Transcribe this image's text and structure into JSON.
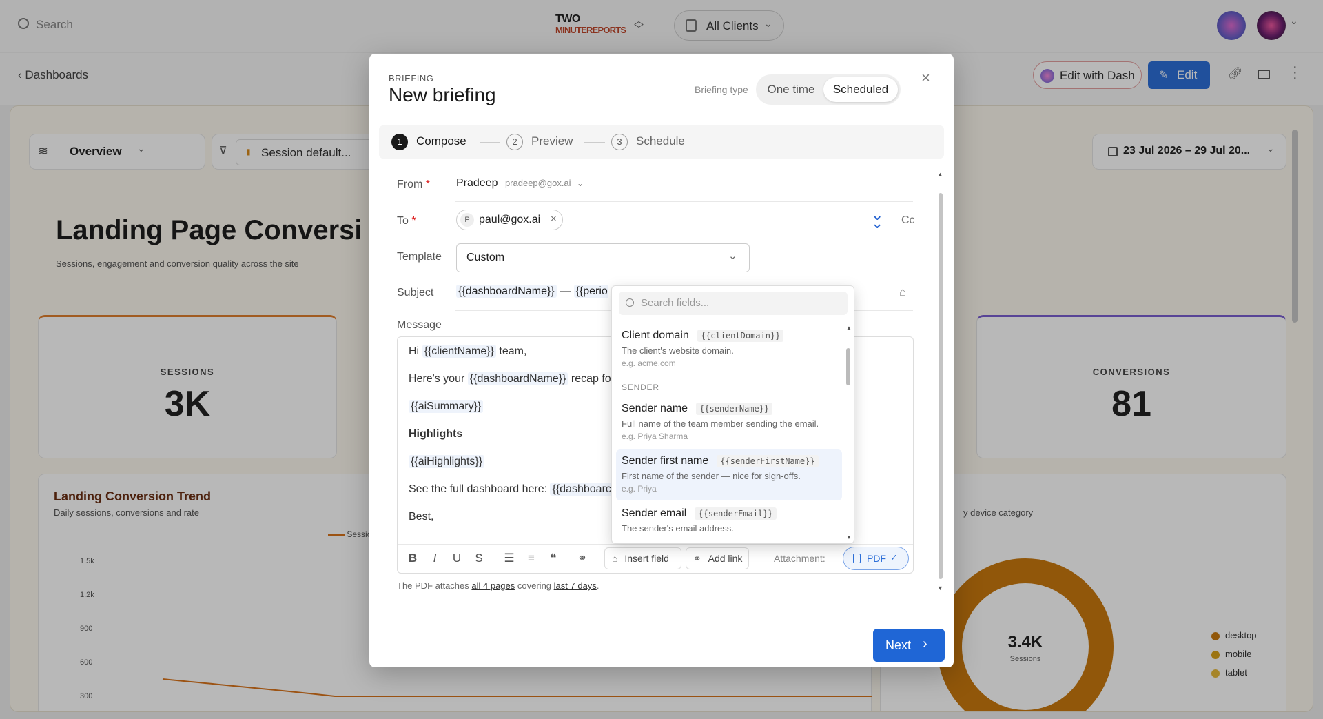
{
  "app": {
    "search_placeholder": "Search",
    "logo_line1": "TWO",
    "logo_line2": "MINUTEREPORTS",
    "client_selector": "All Clients"
  },
  "subbar": {
    "back_label": "Dashboards",
    "edit_with_dash": "Edit with Dash",
    "edit": "Edit"
  },
  "dashboard": {
    "tab": "Overview",
    "filter_chip": "Session default...",
    "date_range": "23 Jul 2026 – 29 Jul 20...",
    "title": "Landing Page Conversi",
    "subtitle": "Sessions, engagement and conversion quality across the site",
    "kpis": [
      {
        "label": "SESSIONS",
        "value": "3K"
      },
      {
        "label": "CONVERSIONS",
        "value": "81"
      }
    ],
    "trend": {
      "title": "Landing Conversion Trend",
      "subtitle": "Daily sessions, conversions and rate",
      "legend": "Sessio",
      "yticks": [
        "1.5k",
        "1.2k",
        "900",
        "600",
        "300"
      ]
    },
    "donut": {
      "subtitle": "y device category",
      "center_value": "3.4K",
      "center_label": "Sessions",
      "legend": [
        {
          "label": "desktop",
          "color": "#c9790f"
        },
        {
          "label": "mobile",
          "color": "#d9a21b"
        },
        {
          "label": "tablet",
          "color": "#e6b93a"
        }
      ]
    }
  },
  "modal": {
    "eyebrow": "BRIEFING",
    "title": "New briefing",
    "type_label": "Briefing type",
    "type_options": [
      "One time",
      "Scheduled"
    ],
    "selected_type": "Scheduled",
    "steps": [
      {
        "num": "1",
        "label": "Compose"
      },
      {
        "num": "2",
        "label": "Preview"
      },
      {
        "num": "3",
        "label": "Schedule"
      }
    ],
    "from_label": "From",
    "from_name": "Pradeep",
    "from_email": "pradeep@gox.ai",
    "to_label": "To",
    "to_chip_initial": "P",
    "to_chip": "paul@gox.ai",
    "cc": "Cc",
    "template_label": "Template",
    "template_value": "Custom",
    "subject_label": "Subject",
    "subject_token1": "{{dashboardName}}",
    "subject_sep": " — ",
    "subject_token2": "{{perioc",
    "message_label": "Message",
    "message": {
      "l1_pre": "Hi ",
      "l1_token": "{{clientName}}",
      "l1_post": " team,",
      "l2_pre": "Here's your ",
      "l2_token": "{{dashboardName}}",
      "l2_post": " recap fo",
      "l3_token": "{{aiSummary}}",
      "l4": "Highlights",
      "l5_token": "{{aiHighlights}}",
      "l6_pre": "See the full dashboard here: ",
      "l6_token": "{{dashboarc",
      "l7": "Best,"
    },
    "insert_field": "Insert field",
    "add_link": "Add link",
    "attachment_label": "Attachment:",
    "attachment_value": "PDF",
    "footnote_pre": "The PDF attaches ",
    "footnote_pages": "all 4 pages",
    "footnote_mid": " covering ",
    "footnote_range": "last 7 days",
    "footnote_post": ".",
    "next": "Next"
  },
  "fields_dropdown": {
    "search_placeholder": "Search fields...",
    "items": [
      {
        "title": "Client domain",
        "code": "{{clientDomain}}",
        "desc": "The client's website domain.",
        "eg": "e.g. acme.com"
      },
      {
        "title": "Sender name",
        "code": "{{senderName}}",
        "desc": "Full name of the team member sending the email.",
        "eg": "e.g. Priya Sharma"
      },
      {
        "title": "Sender first name",
        "code": "{{senderFirstName}}",
        "desc": "First name of the sender — nice for sign-offs.",
        "eg": "e.g. Priya"
      },
      {
        "title": "Sender email",
        "code": "{{senderEmail}}",
        "desc": "The sender's email address.",
        "eg": ""
      }
    ],
    "section_sender": "SENDER"
  }
}
